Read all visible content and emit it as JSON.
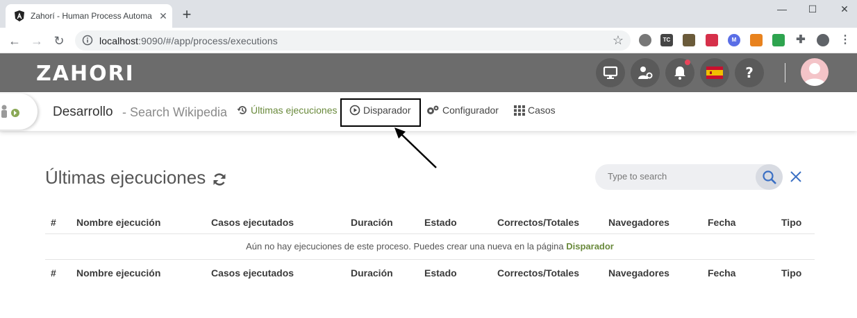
{
  "browser": {
    "tab_title": "Zahorí - Human Process Automa",
    "url_host": "localhost",
    "url_rest": ":9090/#/app/process/executions"
  },
  "app": {
    "logo": "ZAHORI",
    "header_icons": [
      "monitor-icon",
      "user-settings-icon",
      "bell-icon",
      "spain-flag-icon",
      "help-icon"
    ]
  },
  "subnav": {
    "project": "Desarrollo",
    "separator": " - ",
    "process": "Search Wikipedia",
    "items": [
      {
        "label": "Últimas ejecuciones",
        "icon": "history-icon"
      },
      {
        "label": "Disparador",
        "icon": "play-circle-icon"
      },
      {
        "label": "Configurador",
        "icon": "cogs-icon"
      },
      {
        "label": "Casos",
        "icon": "grid-icon"
      }
    ]
  },
  "main": {
    "title": "Últimas ejecuciones",
    "search_placeholder": "Type to search",
    "columns": [
      "#",
      "Nombre ejecución",
      "Casos ejecutados",
      "Duración",
      "Estado",
      "Correctos/Totales",
      "Navegadores",
      "Fecha",
      "Tipo"
    ],
    "empty_text": "Aún no hay ejecuciones de este proceso. Puedes crear una nueva en la página",
    "empty_link": "Disparador"
  },
  "colors": {
    "header_bg": "#6c6c6c",
    "accent_green": "#6a8a3c",
    "search_icon": "#3a6fc4"
  }
}
